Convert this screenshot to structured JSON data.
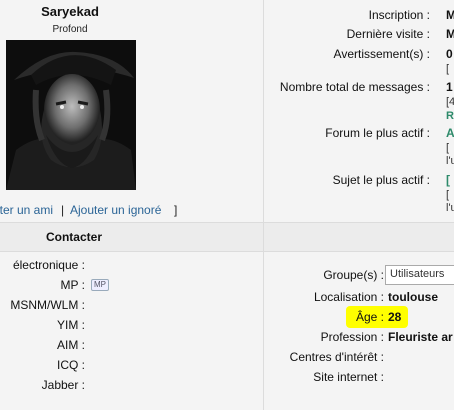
{
  "profile": {
    "username": "Saryekad",
    "rank": "Profond",
    "add_friend_link": "jter un ami",
    "separator1": "|",
    "add_ignored_link": "Ajouter un ignoré",
    "separator2": "]"
  },
  "stats": {
    "inscription_label": "Inscription :",
    "inscription_value": "M",
    "last_visit_label": "Dernière visite :",
    "last_visit_value": "M",
    "warnings_label": "Avertissement(s) :",
    "warnings_value": "0",
    "warnings_sub": "[",
    "total_messages_label": "Nombre total de messages :",
    "total_messages_value": "1",
    "total_messages_sub1": "[4",
    "total_messages_sub2": "R",
    "most_active_forum_label": "Forum le plus actif :",
    "most_active_forum_value": "A",
    "most_active_forum_sub1": "[",
    "most_active_forum_sub2": "l'u",
    "most_active_topic_label": "Sujet le plus actif :",
    "most_active_topic_value": "[",
    "most_active_topic_sub1": "[",
    "most_active_topic_sub2": "l'u"
  },
  "contact": {
    "title": "Contacter",
    "email_label": "électronique :",
    "mp_label": "MP :",
    "mp_badge": "MP",
    "msnm_label": "MSNM/WLM :",
    "yim_label": "YIM :",
    "aim_label": "AIM :",
    "icq_label": "ICQ :",
    "jabber_label": "Jabber :"
  },
  "about": {
    "groups_label": "Groupe(s) :",
    "groups_value": "Utilisateurs",
    "location_label": "Localisation :",
    "location_value": "toulouse",
    "age_label": "Âge :",
    "age_value": "28",
    "profession_label": "Profession :",
    "profession_value": "Fleuriste ar",
    "interests_label": "Centres d'intérêt :",
    "website_label": "Site internet :"
  },
  "colors": {
    "highlight": "#ffff00",
    "link": "#2a6496",
    "accent_green": "#2d8a6a"
  }
}
